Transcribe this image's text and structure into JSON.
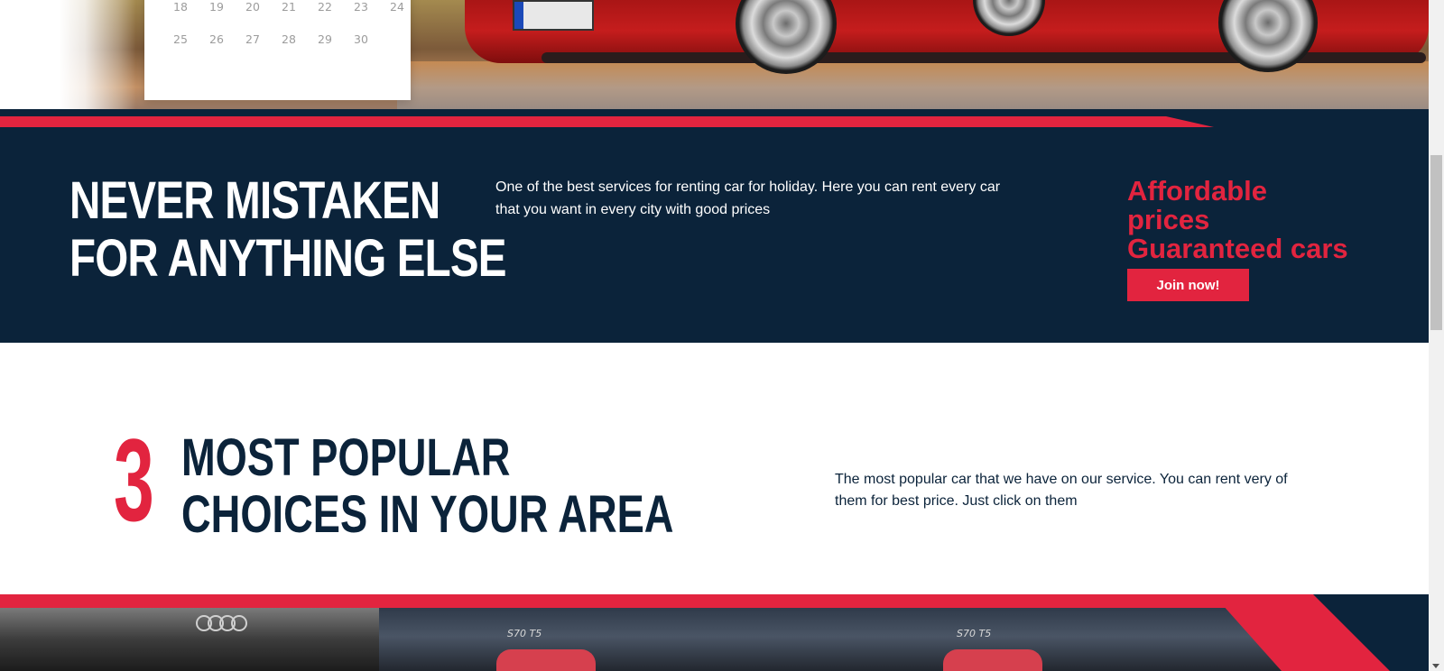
{
  "calendar": {
    "rows": [
      [
        "18",
        "19",
        "20",
        "21",
        "22",
        "23",
        "24"
      ],
      [
        "25",
        "26",
        "27",
        "28",
        "29",
        "30",
        ""
      ]
    ]
  },
  "feature_band": {
    "title_line1": "NEVER MISTAKEN",
    "title_line2": "FOR ANYTHING ELSE",
    "description": "One of the best services for renting car for holiday. Here you can rent every car that you want in every city with good prices",
    "promo_line1": "Affordable",
    "promo_line2": "prices",
    "promo_line3": "Guaranteed cars",
    "button_label": "Join now!"
  },
  "popular_section": {
    "number": "3",
    "title_line1": "MOST POPULAR",
    "title_line2": "CHOICES IN YOUR AREA",
    "description": "The most popular car that we have on our service. You can rent very of them for best price. Just click on them"
  },
  "gallery": {
    "badge_1": "S70 T5",
    "badge_2": "S70 T5"
  },
  "colors": {
    "accent_red": "#e2243f",
    "navy": "#0b233a"
  },
  "icons": {
    "scroll_down": "chevron-down-icon",
    "brand_logo": "audi-rings-logo"
  }
}
